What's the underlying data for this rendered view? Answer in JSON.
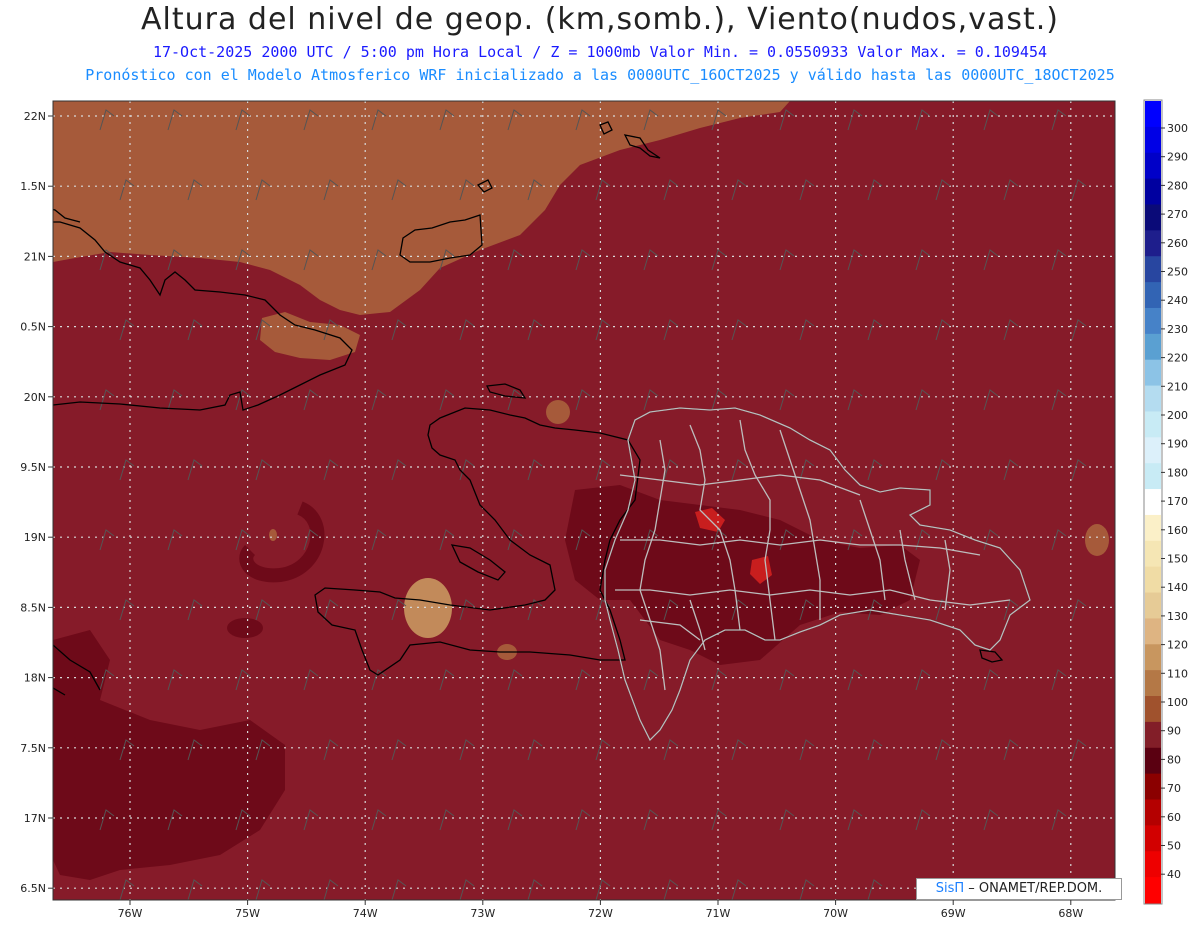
{
  "header": {
    "title": "Altura del nivel de geop. (km,somb.), Viento(nudos,vast.)",
    "line1": "17-Oct-2025  2000 UTC / 5:00 pm Hora Local / Z = 1000mb  Valor Min. = 0.0550933  Valor Max. = 0.109454",
    "line2": "Pronóstico con el Modelo Atmosferico WRF inicializado a las 0000UTC_16OCT2025 y válido hasta las  0000UTC_18OCT2025"
  },
  "axes": {
    "lat_labels": [
      "22N",
      "1.5N",
      "21N",
      "0.5N",
      "20N",
      "9.5N",
      "19N",
      "8.5N",
      "18N",
      "7.5N",
      "17N",
      "6.5N"
    ],
    "lon_labels": [
      "76W",
      "75W",
      "74W",
      "73W",
      "72W",
      "71W",
      "70W",
      "69W",
      "68W"
    ]
  },
  "colorbar": {
    "labels": [
      "300",
      "290",
      "280",
      "270",
      "260",
      "250",
      "240",
      "230",
      "220",
      "210",
      "200",
      "190",
      "180",
      "170",
      "160",
      "150",
      "140",
      "130",
      "120",
      "110",
      "100",
      "90",
      "80",
      "70",
      "60",
      "50",
      "40"
    ],
    "colors": [
      "#0000ff",
      "#0000e6",
      "#0000c8",
      "#0000a0",
      "#0a0a78",
      "#1e1e8c",
      "#2846a0",
      "#3264b4",
      "#4682c8",
      "#5aa0d2",
      "#8cc3e6",
      "#b4dcf0",
      "#c8ebf5",
      "#dcf0fa",
      "#c8ebf5",
      "#ffffff",
      "#fbf0c8",
      "#f5e6b4",
      "#f0dca5",
      "#e6cb96",
      "#deb482",
      "#c8965f",
      "#b47846",
      "#a0522d",
      "#821e28",
      "#5a0011",
      "#8b0000",
      "#b40000",
      "#d20000",
      "#ee0000",
      "#ff0000"
    ]
  },
  "map": {
    "colors": {
      "base": "#861b29",
      "dark": "#6e0a19",
      "tan": "#a65a3a",
      "light_tan": "#c28a5a",
      "red": "#c81e1e",
      "coast": "#000000",
      "border": "#bdbdbd",
      "grid": "#d9d9d9",
      "barb": "#555555"
    }
  },
  "credit": {
    "brand": "SisΠ",
    "text": "– ONAMET/REP.DOM."
  }
}
